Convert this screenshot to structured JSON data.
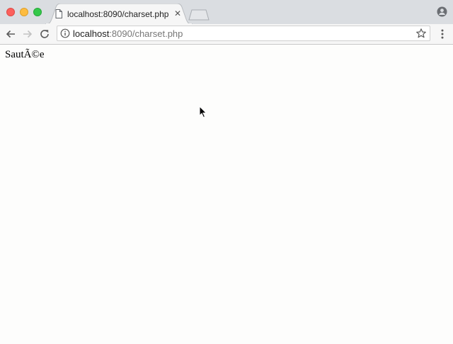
{
  "window": {
    "controls": [
      "close",
      "minimize",
      "maximize"
    ]
  },
  "tabs": [
    {
      "title": "localhost:8090/charset.php",
      "icon": "page-icon",
      "active": true
    }
  ],
  "toolbar": {
    "back_icon": "back-arrow-icon",
    "forward_icon": "forward-arrow-icon",
    "reload_icon": "reload-icon",
    "address": {
      "host": "localhost",
      "rest": ":8090/charset.php"
    },
    "star_icon": "star-icon",
    "menu_icon": "kebab-menu-icon"
  },
  "content": {
    "text": "SautÃ©e"
  },
  "colors": {
    "close": "#fc605c",
    "minimize": "#fdbc40",
    "maximize": "#34c84a",
    "tabstrip": "#dadde1",
    "toolbar": "#f6f6f6",
    "page_bg": "#fdfdfc"
  }
}
